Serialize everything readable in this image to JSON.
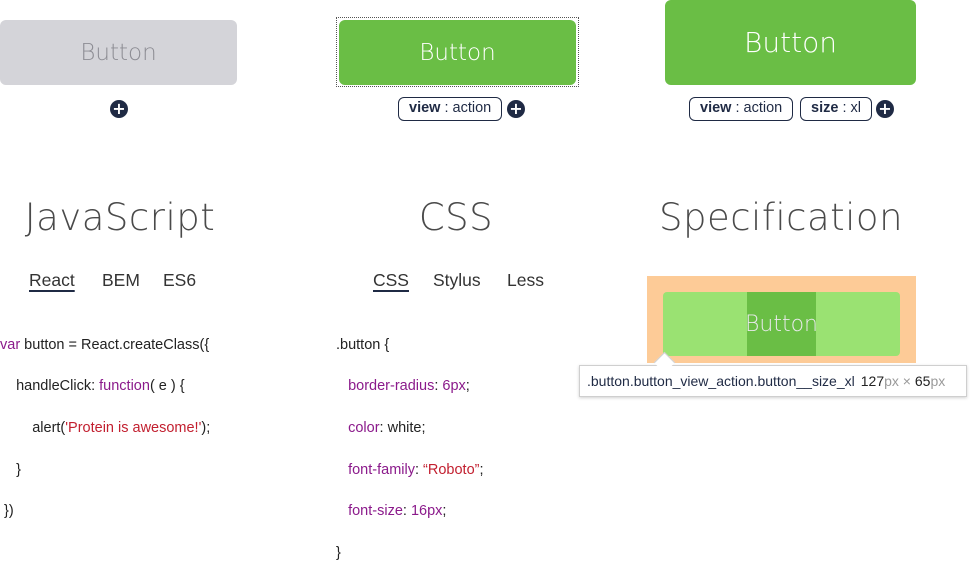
{
  "examples": {
    "default_button_label": "Button",
    "action_button_label": "Button",
    "xl_button_label": "Button",
    "plus_symbol": "+",
    "tag_view": {
      "key": "view",
      "sep": " : ",
      "value": "action"
    },
    "tag_size": {
      "key": "size",
      "sep": " : ",
      "value": "xl"
    }
  },
  "sections": {
    "javascript": {
      "title": "JavaScript",
      "tabs": [
        "React",
        "BEM",
        "ES6"
      ]
    },
    "css": {
      "title": "CSS",
      "tabs": [
        "CSS",
        "Stylus",
        "Less"
      ]
    },
    "specification": {
      "title": "Specification"
    }
  },
  "code_js": {
    "l1_kw": "var",
    "l1_rest": " button = React.createClass({",
    "l2_a": "    handleClick: ",
    "l2_kw": "function",
    "l2_b": "( e ) {",
    "l3_a": "        alert(",
    "l3_str": "'Protein is awesome!'",
    "l3_b": ");",
    "l4": "    }",
    "l5": " })"
  },
  "code_css": {
    "selector": ".button {",
    "decls": [
      {
        "prop": "border-radius",
        "value": "6px",
        "unit": ""
      },
      {
        "prop": "color",
        "value": "white",
        "unit": ""
      },
      {
        "prop": "font-family",
        "value": "“Roboto”",
        "unit": ""
      },
      {
        "prop": "font-size",
        "value": "16px",
        "unit": ""
      }
    ],
    "close": "}"
  },
  "spec": {
    "button_label": "Button",
    "tooltip_selector": ".button.button_view_action.button__size_xl",
    "width_value": "127",
    "height_value": "65",
    "unit": "px",
    "times": "×"
  },
  "colors": {
    "green": "#6abe45",
    "light_green": "#9ae272",
    "gray_button": "#d4d4d9",
    "margin_orange": "#fdcb97",
    "navy": "#1f2a44",
    "purple": "#8b1a8b",
    "red": "#c21f2f"
  }
}
